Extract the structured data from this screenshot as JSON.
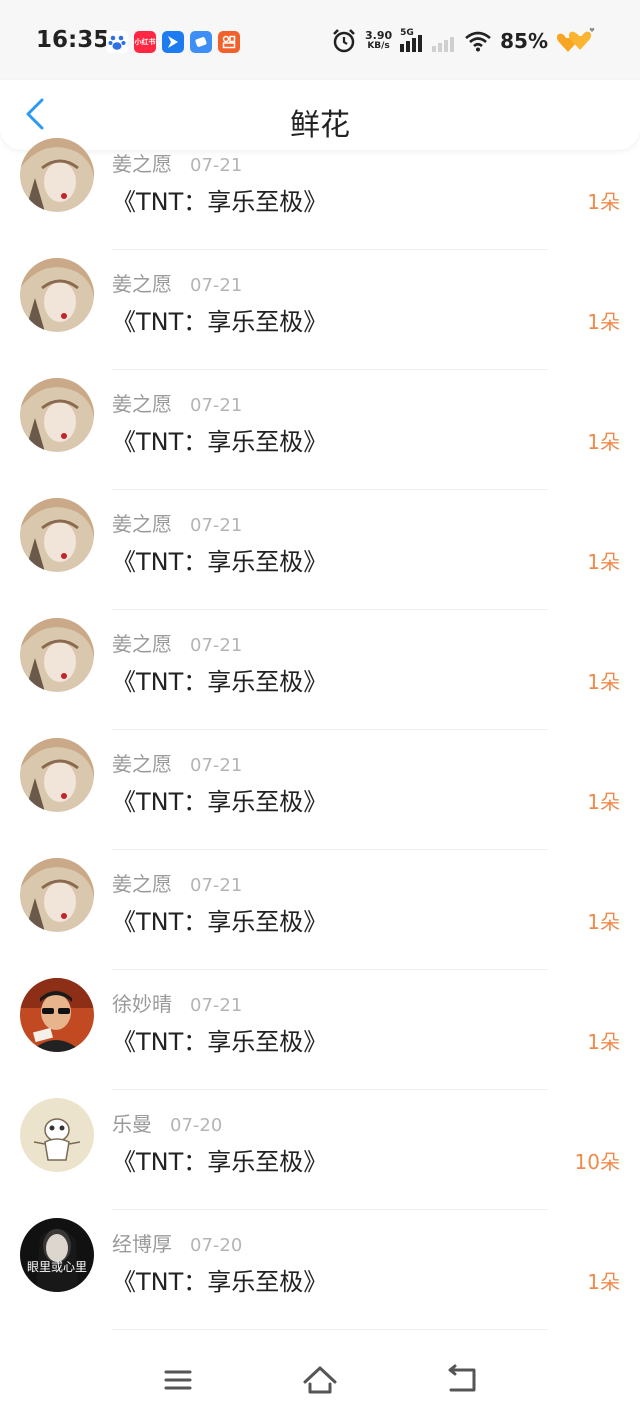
{
  "status_bar": {
    "time": "16:35",
    "net_speed_value": "3.90",
    "net_speed_unit": "KB/s",
    "network_type": "5G",
    "battery": "85%"
  },
  "header": {
    "title": "鲜花"
  },
  "items": [
    {
      "name": "姜之愿",
      "date": "07-21",
      "title": "《TNT：享乐至极》",
      "count": "1朵"
    },
    {
      "name": "姜之愿",
      "date": "07-21",
      "title": "《TNT：享乐至极》",
      "count": "1朵"
    },
    {
      "name": "姜之愿",
      "date": "07-21",
      "title": "《TNT：享乐至极》",
      "count": "1朵"
    },
    {
      "name": "姜之愿",
      "date": "07-21",
      "title": "《TNT：享乐至极》",
      "count": "1朵"
    },
    {
      "name": "姜之愿",
      "date": "07-21",
      "title": "《TNT：享乐至极》",
      "count": "1朵"
    },
    {
      "name": "姜之愿",
      "date": "07-21",
      "title": "《TNT：享乐至极》",
      "count": "1朵"
    },
    {
      "name": "姜之愿",
      "date": "07-21",
      "title": "《TNT：享乐至极》",
      "count": "1朵"
    },
    {
      "name": "徐妙晴",
      "date": "07-21",
      "title": "《TNT：享乐至极》",
      "count": "1朵"
    },
    {
      "name": "乐曼",
      "date": "07-20",
      "title": "《TNT：享乐至极》",
      "count": "10朵"
    },
    {
      "name": "经博厚",
      "date": "07-20",
      "title": "《TNT：享乐至极》",
      "count": "1朵",
      "avatar_text": "眼里或心里"
    }
  ],
  "colors": {
    "accent": "#2b9af3",
    "count": "#f08a4b"
  }
}
